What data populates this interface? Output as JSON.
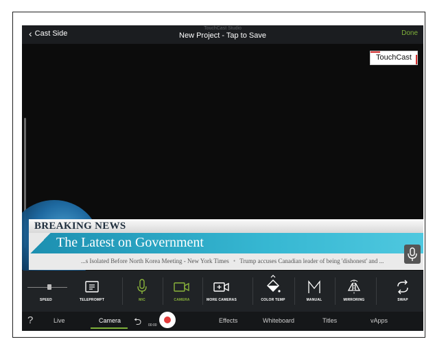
{
  "topbar": {
    "back_label": "Cast Side",
    "app_name": "TouchCast Studio",
    "title": "New Project - Tap to Save",
    "done_label": "Done"
  },
  "view": {
    "logo_text": "TouchCast",
    "breaking_label": "BREAKING NEWS",
    "headline": "The Latest on Government",
    "ticker_1": "...s Isolated Before North Korea Meeting - New York Times",
    "ticker_2": "Trump accuses Canadian leader of being 'dishonest' and ...",
    "ticker_sep": "•"
  },
  "toolbar": {
    "items": [
      {
        "label": "SPEED",
        "icon": "slider-icon"
      },
      {
        "label": "TELEPROMPT",
        "icon": "teleprompt-icon"
      },
      {
        "label": "MIC",
        "icon": "microphone-icon",
        "active": true
      },
      {
        "label": "CAMERA",
        "icon": "camera-icon",
        "active": true
      },
      {
        "label": "MORE CAMERAS",
        "icon": "add-camera-icon"
      },
      {
        "label": "COLOR TEMP",
        "icon": "color-temp-icon"
      },
      {
        "label": "MANUAL",
        "icon": "manual-icon"
      },
      {
        "label": "MIRRORING",
        "icon": "mirroring-icon"
      },
      {
        "label": "SWAP",
        "icon": "swap-icon"
      }
    ],
    "speed_level": 0.55
  },
  "tabs": {
    "help": "?",
    "live": "Live",
    "camera": "Camera",
    "timer": "00:00",
    "effects": "Effects",
    "whiteboard": "Whiteboard",
    "titles": "Titles",
    "vapps": "vApps"
  },
  "colors": {
    "accent": "#7fb23a",
    "record": "#e23b3b",
    "headline_bar": "#36b7d2"
  }
}
